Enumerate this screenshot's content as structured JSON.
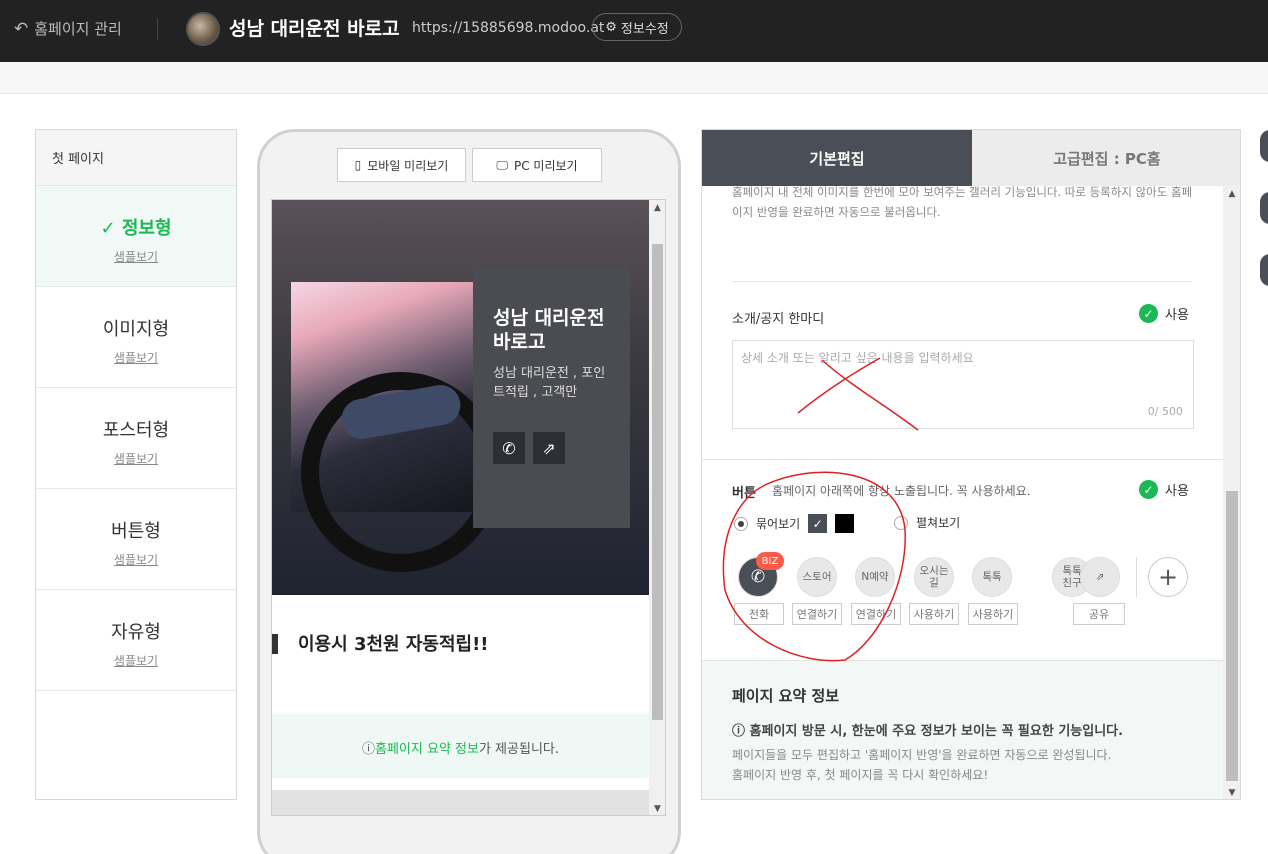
{
  "topbar": {
    "back_label": "홈페이지 관리",
    "site_title": "성남 대리운전 바로고",
    "site_url": "https://15885698.modoo.at",
    "info_edit_label": "정보수정"
  },
  "sidebar": {
    "header": "첫 페이지",
    "items": [
      {
        "name": "정보형",
        "sample": "샘플보기",
        "check": "✓"
      },
      {
        "name": "이미지형",
        "sample": "샘플보기"
      },
      {
        "name": "포스터형",
        "sample": "샘플보기"
      },
      {
        "name": "버튼형",
        "sample": "샘플보기"
      },
      {
        "name": "자유형",
        "sample": "샘플보기"
      }
    ]
  },
  "preview": {
    "mobile_label": "모바일 미리보기",
    "pc_label": "PC 미리보기",
    "hero_title": "성남 대리운전 바로고",
    "hero_sub": "성남 대리운전 , 포인트적립 , 고객만",
    "notice": "이용시 3천원 자동적립!!",
    "summary_link": "홈페이지 요약 정보",
    "summary_rest": "가 제공됩니다."
  },
  "editor": {
    "tab_basic": "기본편집",
    "tab_advanced": "고급편집 : PC홈",
    "gallery_desc": "홈페이지 내 전체 이미지를 한번에 모아 보여주는 갤러리 기능입니다. 따로 등록하지 않아도 홈페이지 반영을 완료하면 자동으로 불러옵니다.",
    "intro_label": "소개/공지 한마디",
    "use_label": "사용",
    "intro_placeholder": "상세 소개 또는 알리고 싶은 내용을 입력하세요",
    "intro_counter": "0/ 500",
    "button_label": "버튼",
    "button_desc": "홈페이지 아래쪽에 항상 노출됩니다. 꼭 사용하세요.",
    "grouped_label": "묶어보기",
    "expanded_label": "펼쳐보기",
    "biz_badge": "BIZ",
    "circles": [
      "스토어",
      "N예약",
      "오시는길",
      "톡톡",
      "톡톡\n친구"
    ],
    "boxes": [
      "전화",
      "연결하기",
      "연결하기",
      "사용하기",
      "사용하기",
      "공유"
    ],
    "summary_title": "페이지 요약 정보",
    "summary_main": "홈페이지 방문 시, 한눈에 주요 정보가 보이는 꼭 필요한 기능입니다.",
    "summary_sub1": "페이지들을 모두 편집하고 '홈페이지 반영'을 완료하면 자동으로 완성됩니다.",
    "summary_sub2": "홈페이지 반영 후, 첫 페이지를 꼭 다시 확인하세요!"
  },
  "colors": {
    "accent_green": "#1bb954",
    "topbar": "#222222",
    "annotation_red": "#e02020"
  }
}
